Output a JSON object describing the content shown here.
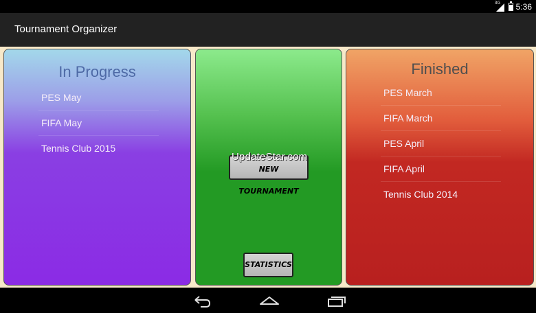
{
  "status_bar": {
    "network": "3G",
    "time": "5:36"
  },
  "action_bar": {
    "title": "Tournament Organizer"
  },
  "in_progress": {
    "title": "In Progress",
    "items": [
      "PES May",
      "FIFA May",
      "Tennis Club 2015"
    ]
  },
  "middle": {
    "new_tournament_label": "NEW TOURNAMENT",
    "statistics_label": "STATISTICS",
    "watermark": "UpdateStar.com"
  },
  "finished": {
    "title": "Finished",
    "items": [
      "PES March",
      "FIFA March",
      "PES April",
      "FIFA April",
      "Tennis Club 2014"
    ]
  },
  "colors": {
    "in_progress_top": "#a3d8ea",
    "in_progress_bottom": "#8b2be5",
    "middle_top": "#8cea8c",
    "middle_bottom": "#239a24",
    "finished_top": "#f0a466",
    "finished_bottom": "#b8201f",
    "background": "#f7e9c9"
  },
  "nav_icons": [
    "back-icon",
    "home-icon",
    "recent-apps-icon"
  ]
}
